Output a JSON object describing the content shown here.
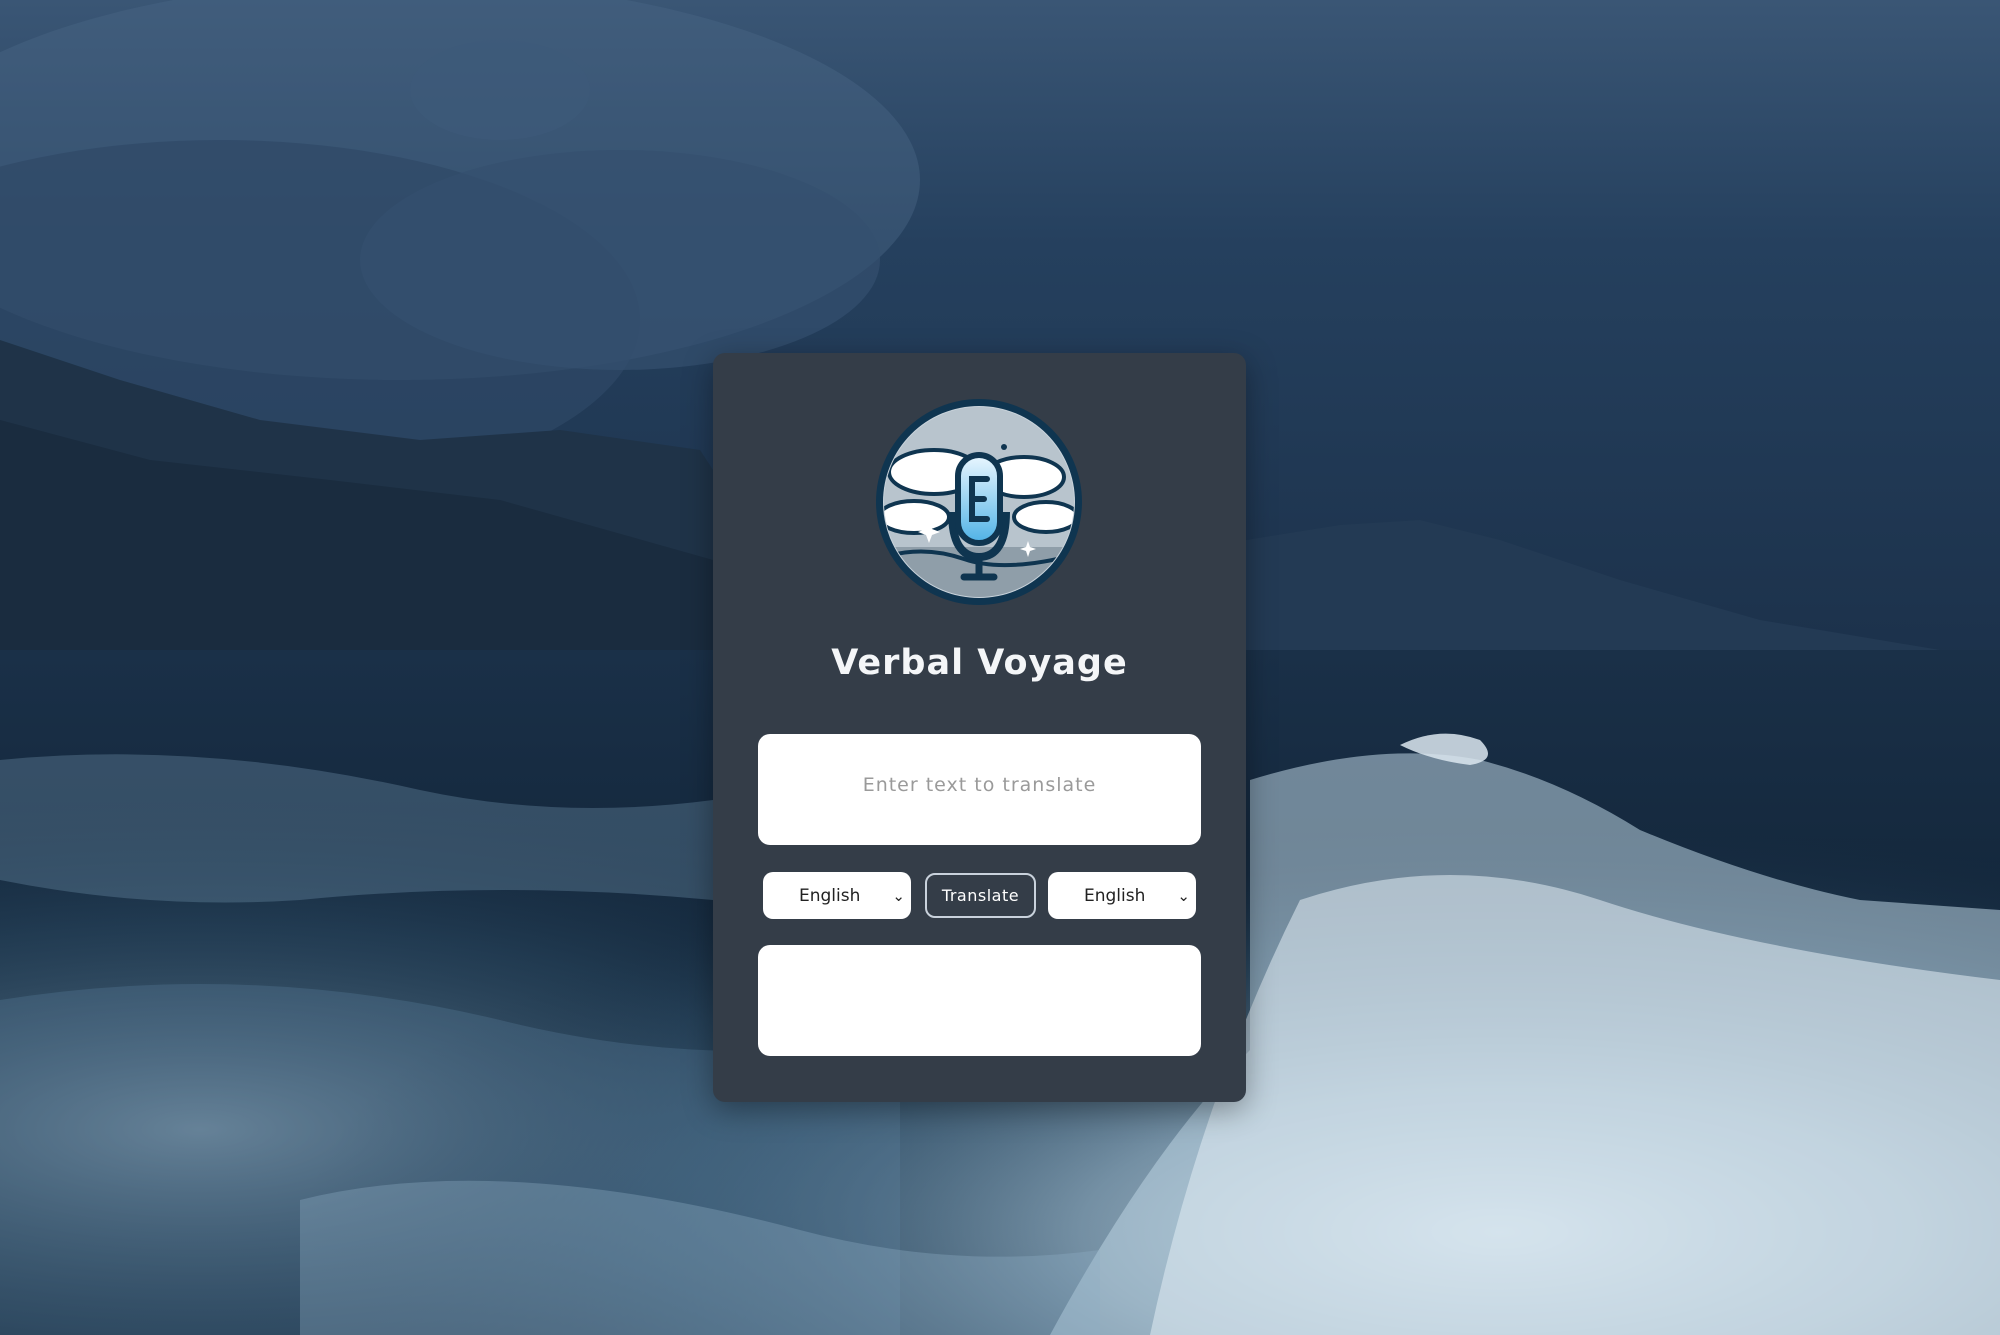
{
  "app": {
    "title": "Verbal Voyage"
  },
  "input": {
    "placeholder": "Enter text to translate",
    "value": ""
  },
  "source_language": {
    "selected": "English"
  },
  "target_language": {
    "selected": "English"
  },
  "translate_button": {
    "label": "Translate"
  },
  "output": {
    "value": ""
  },
  "icons": {
    "logo": "microphone-logo-icon",
    "dropdown": "chevron-down-icon"
  },
  "colors": {
    "card_background": "#343d48",
    "title_text": "#f4f6f8",
    "input_background": "#ffffff",
    "placeholder_text": "#9a9a9a",
    "button_border": "#c9d2dc",
    "sky_dark": "#1c3149",
    "sea_dark": "#0f2236",
    "foam": "#d9e6ef"
  }
}
